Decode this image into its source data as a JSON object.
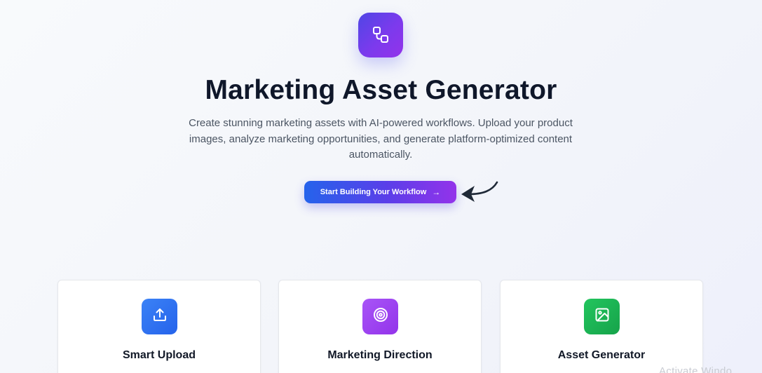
{
  "hero": {
    "logo_icon": "workflow-icon",
    "title": "Marketing Asset Generator",
    "subtitle": "Create stunning marketing assets with AI-powered workflows. Upload your product images, analyze marketing opportunities, and generate platform-optimized content automatically.",
    "cta_label": "Start Building Your Workflow",
    "cta_icon": "arrow-right-icon",
    "pointer_icon": "curved-arrow-icon"
  },
  "features": [
    {
      "icon": "upload-icon",
      "title": "Smart Upload",
      "color": "#2563eb"
    },
    {
      "icon": "target-icon",
      "title": "Marketing Direction",
      "color": "#9333ea"
    },
    {
      "icon": "image-icon",
      "title": "Asset Generator",
      "color": "#16a34a"
    }
  ],
  "os_watermark": "Activate Windo",
  "colors": {
    "brand_indigo": "#4f46e5",
    "brand_purple": "#9333ea",
    "brand_blue": "#2563eb",
    "title_text": "#0f172a",
    "body_text": "#4b5563"
  }
}
